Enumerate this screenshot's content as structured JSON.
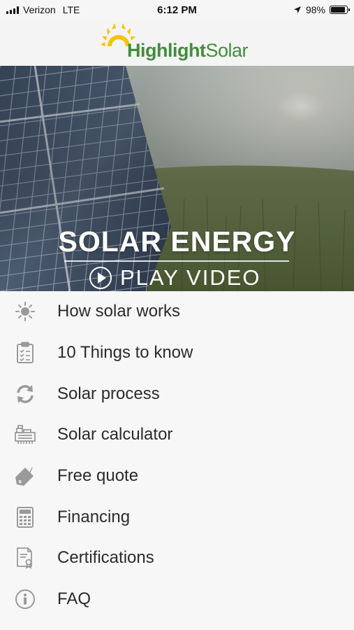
{
  "status_bar": {
    "carrier": "Verizon",
    "network": "LTE",
    "time": "6:12 PM",
    "battery_text": "98%",
    "battery_level": 0.98
  },
  "header": {
    "logo_text_1": "Highlight",
    "logo_text_2": "Solar",
    "brand_color": "#3f8f3b",
    "sun_color": "#f5c400"
  },
  "hero": {
    "title": "SOLAR ENERGY",
    "play_label": "PLAY VIDEO"
  },
  "menu": {
    "items": [
      {
        "label": "How solar works",
        "icon": "sun-icon"
      },
      {
        "label": "10 Things to know",
        "icon": "checklist-icon"
      },
      {
        "label": "Solar process",
        "icon": "refresh-icon"
      },
      {
        "label": "Solar calculator",
        "icon": "calculator-tape-icon"
      },
      {
        "label": "Free quote",
        "icon": "price-tag-icon"
      },
      {
        "label": "Financing",
        "icon": "calculator-icon"
      },
      {
        "label": "Certifications",
        "icon": "certificate-icon"
      },
      {
        "label": "FAQ",
        "icon": "info-icon"
      }
    ],
    "icon_color": "#9a9a9a"
  }
}
